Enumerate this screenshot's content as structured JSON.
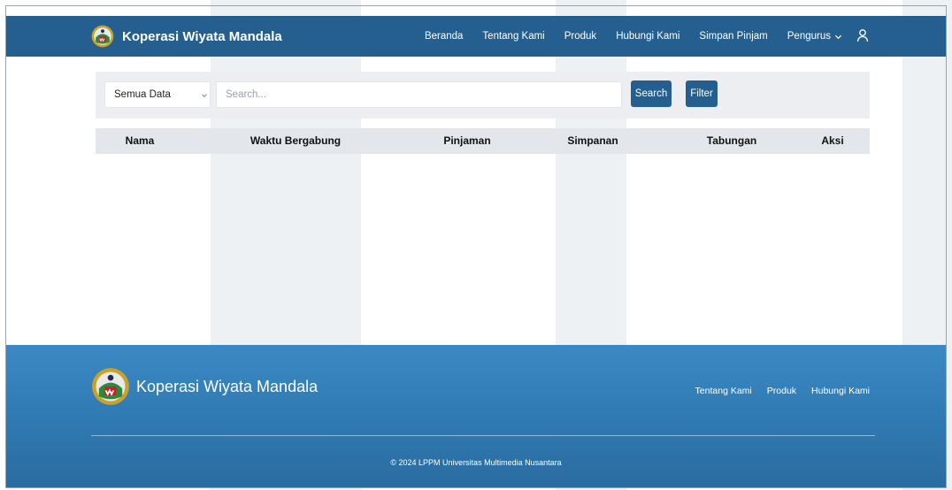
{
  "header": {
    "brand": "Koperasi Wiyata Mandala",
    "nav": [
      {
        "label": "Beranda"
      },
      {
        "label": "Tentang Kami"
      },
      {
        "label": "Produk"
      },
      {
        "label": "Hubungi Kami"
      },
      {
        "label": "Simpan Pinjam"
      },
      {
        "label": "Pengurus"
      }
    ],
    "icons": {
      "dropdown": "chevron-down-icon",
      "user": "user-icon"
    }
  },
  "filter": {
    "select_value": "Semua Data",
    "search_placeholder": "Search...",
    "search_value": "",
    "search_button": "Search",
    "filter_button": "Filter"
  },
  "table": {
    "columns": [
      "Nama",
      "Waktu Bergabung",
      "Pinjaman",
      "Simpanan",
      "Tabungan",
      "Aksi"
    ],
    "rows": []
  },
  "footer": {
    "brand": "Koperasi Wiyata Mandala",
    "links": [
      {
        "label": "Tentang Kami"
      },
      {
        "label": "Produk"
      },
      {
        "label": "Hubungi Kami"
      }
    ],
    "copyright": "© 2024 LPPM Universitas Multimedia Nusantara"
  },
  "colors": {
    "primary": "#245f8f",
    "footer": "#3b89c4",
    "filter_bg": "#eceef1",
    "table_header_bg": "#e3e6ea"
  }
}
